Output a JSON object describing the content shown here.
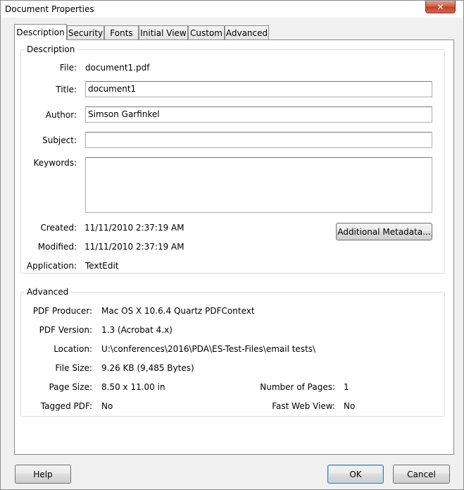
{
  "window": {
    "title": "Document Properties",
    "close_glyph": "✕"
  },
  "tabs": [
    {
      "label": "Description",
      "active": true
    },
    {
      "label": "Security"
    },
    {
      "label": "Fonts"
    },
    {
      "label": "Initial View"
    },
    {
      "label": "Custom"
    },
    {
      "label": "Advanced"
    }
  ],
  "description": {
    "legend": "Description",
    "file_label": "File:",
    "file_value": "document1.pdf",
    "title_label": "Title:",
    "title_value": "document1",
    "author_label": "Author:",
    "author_value": "Simson Garfinkel",
    "subject_label": "Subject:",
    "subject_value": "",
    "keywords_label": "Keywords:",
    "keywords_value": "",
    "created_label": "Created:",
    "created_value": "11/11/2010 2:37:19 AM",
    "modified_label": "Modified:",
    "modified_value": "11/11/2010 2:37:19 AM",
    "application_label": "Application:",
    "application_value": "TextEdit",
    "metadata_button": "Additional Metadata..."
  },
  "advanced": {
    "legend": "Advanced",
    "producer_label": "PDF Producer:",
    "producer_value": "Mac OS X 10.6.4 Quartz PDFContext",
    "version_label": "PDF Version:",
    "version_value": "1.3 (Acrobat 4.x)",
    "location_label": "Location:",
    "location_value": "U:\\conferences\\2016\\PDA\\ES-Test-Files\\email tests\\",
    "filesize_label": "File Size:",
    "filesize_value": "9.26 KB (9,485 Bytes)",
    "pagesize_label": "Page Size:",
    "pagesize_value": "8.50 x 11.00 in",
    "pages_label": "Number of Pages:",
    "pages_value": "1",
    "tagged_label": "Tagged PDF:",
    "tagged_value": "No",
    "fastweb_label": "Fast Web View:",
    "fastweb_value": "No"
  },
  "footer": {
    "help": "Help",
    "ok": "OK",
    "cancel": "Cancel"
  }
}
